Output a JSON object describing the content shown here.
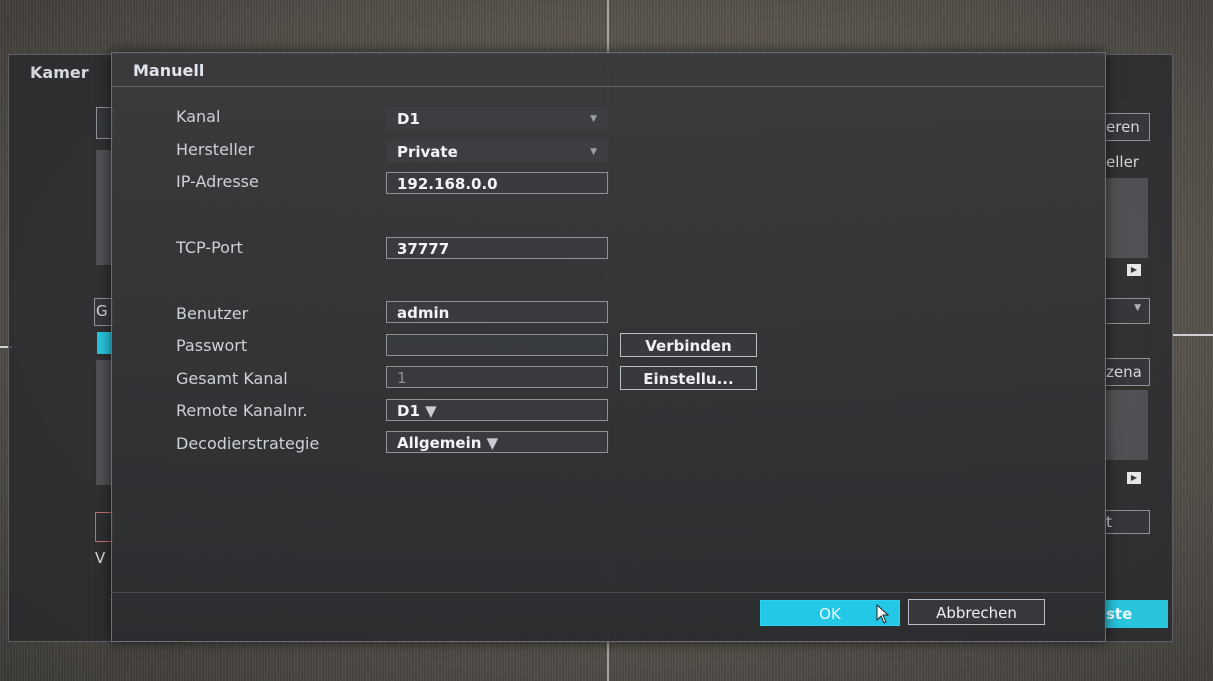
{
  "background_window": {
    "title": "Kamer",
    "right_button_1": "eren",
    "right_text_2": "eller",
    "right_text_3": "zena",
    "right_button_4": "t",
    "right_bottom_button": "ste",
    "left_box_text": "G",
    "left_text_v": "V"
  },
  "dialog": {
    "title": "Manuell",
    "fields": {
      "kanal": {
        "label": "Kanal",
        "value": "D1"
      },
      "hersteller": {
        "label": "Hersteller",
        "value": "Private"
      },
      "ip": {
        "label": "IP-Adresse",
        "value": "192.168.0.0"
      },
      "tcp": {
        "label": "TCP-Port",
        "value": "37777"
      },
      "benutzer": {
        "label": "Benutzer",
        "value": "admin"
      },
      "passwort": {
        "label": "Passwort",
        "value": ""
      },
      "gesamt": {
        "label": "Gesamt Kanal",
        "value": "1"
      },
      "remote": {
        "label": "Remote Kanalnr.",
        "value": "D1"
      },
      "decoder": {
        "label": "Decodierstrategie",
        "value": "Allgemein"
      }
    },
    "buttons": {
      "verbinden": "Verbinden",
      "einstellungen": "Einstellu...",
      "ok": "OK",
      "abbrechen": "Abbrechen"
    }
  },
  "icons": {
    "dropdown": "chevron-down-icon",
    "cursor": "mouse-pointer-icon",
    "scroll_right": "chevron-right-icon"
  },
  "colors": {
    "accent": "#23c8e6",
    "dialog_bg": "#3b3c3f",
    "text": "#cdd1d8"
  }
}
